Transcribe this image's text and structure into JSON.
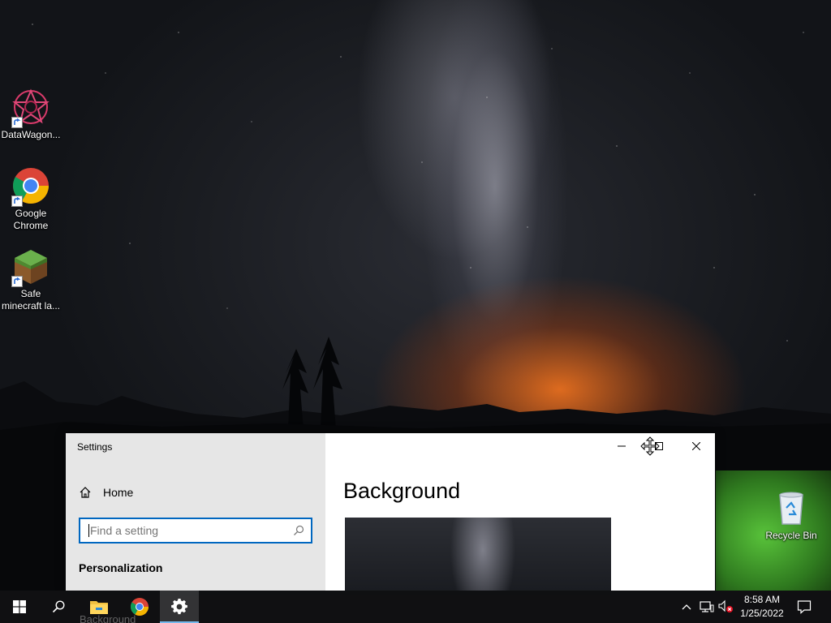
{
  "desktop": {
    "icons": [
      {
        "label": "DataWagon..."
      },
      {
        "label": "Google Chrome"
      },
      {
        "label": "Safe minecraft la..."
      },
      {
        "label": "Recycle Bin"
      }
    ]
  },
  "settings_window": {
    "title": "Settings",
    "home_label": "Home",
    "search_placeholder": "Find a setting",
    "section_label": "Personalization",
    "page_title": "Background"
  },
  "taskbar": {
    "ghost_label": "Background",
    "pinned": [
      "start-icon",
      "search-icon",
      "file-explorer-icon",
      "chrome-icon",
      "settings-gear-icon"
    ],
    "active_app": "Settings",
    "accent_color": "#76b9ed"
  },
  "tray": {
    "time": "8:58 AM",
    "date": "1/25/2022"
  },
  "colors": {
    "search_border": "#0067c0",
    "settings_sidebar": "#e6e6e6"
  }
}
